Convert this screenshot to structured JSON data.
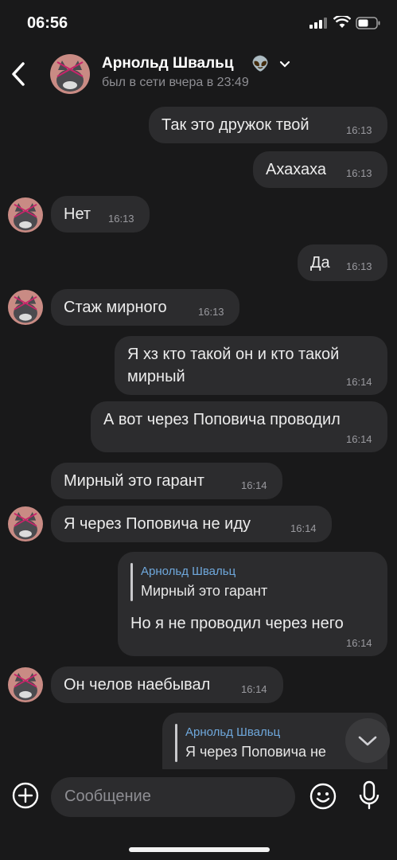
{
  "status_bar": {
    "time": "06:56"
  },
  "header": {
    "name": "Арнольд Швальц",
    "emoji": "👽",
    "status": "был в сети вчера в 23:49"
  },
  "messages": [
    {
      "dir": "out",
      "text": "Так это дружок твой",
      "time": "16:13"
    },
    {
      "dir": "out",
      "text": "Ахахаха",
      "time": "16:13"
    },
    {
      "dir": "in",
      "text": "Нет",
      "time": "16:13"
    },
    {
      "dir": "out",
      "text": "Да",
      "time": "16:13"
    },
    {
      "dir": "in",
      "text": "Стаж мирного",
      "time": "16:13"
    },
    {
      "dir": "out",
      "text_line1": "Я хз кто такой он и кто такой",
      "text_line2": "мирный",
      "time": "16:14"
    },
    {
      "dir": "out",
      "text": "А вот через Поповича проводил",
      "time": "16:14"
    },
    {
      "dir": "in",
      "text": "Мирный это гарант",
      "time": "16:14"
    },
    {
      "dir": "in",
      "text": "Я через Поповича не иду",
      "time": "16:14"
    },
    {
      "dir": "out",
      "reply_name": "Арнольд Швальц",
      "reply_text": "Мирный это гарант",
      "text": "Но я не проводил через него",
      "time": "16:14"
    },
    {
      "dir": "in",
      "text": "Он челов наебывал",
      "time": "16:14"
    },
    {
      "dir": "out",
      "reply_name": "Арнольд Швальц",
      "reply_text": "Я через Поповича не"
    }
  ],
  "composer": {
    "placeholder": "Сообщение"
  },
  "icons": [
    "back-chevron-icon",
    "chevron-down-icon",
    "signal-icon",
    "wifi-icon",
    "battery-icon",
    "plus-circle-icon",
    "emoji-icon",
    "microphone-icon",
    "scroll-down-icon"
  ],
  "colors": {
    "background": "#19191a",
    "bubble": "#2c2c2e",
    "reply_name": "#6fa8dc"
  }
}
